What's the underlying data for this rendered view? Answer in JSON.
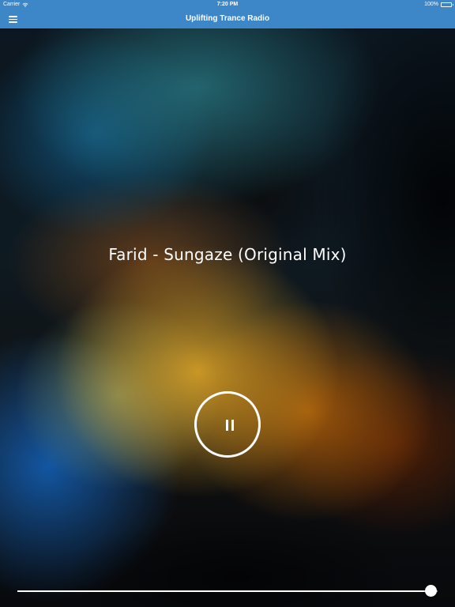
{
  "status_bar": {
    "carrier": "Carrier",
    "time": "7:20 PM",
    "battery": "100%",
    "wifi_icon": "wifi-icon",
    "battery_icon": "battery-icon"
  },
  "nav": {
    "title": "Uplifting Trance Radio",
    "menu_icon": "hamburger-menu-icon"
  },
  "player": {
    "track_title": "Farid - Sungaze (Original Mix)",
    "state": "playing",
    "control_icon": "pause-icon",
    "volume": 1.0
  },
  "theme": {
    "nav_color": "#3d86c8",
    "text_color": "#ffffff"
  }
}
